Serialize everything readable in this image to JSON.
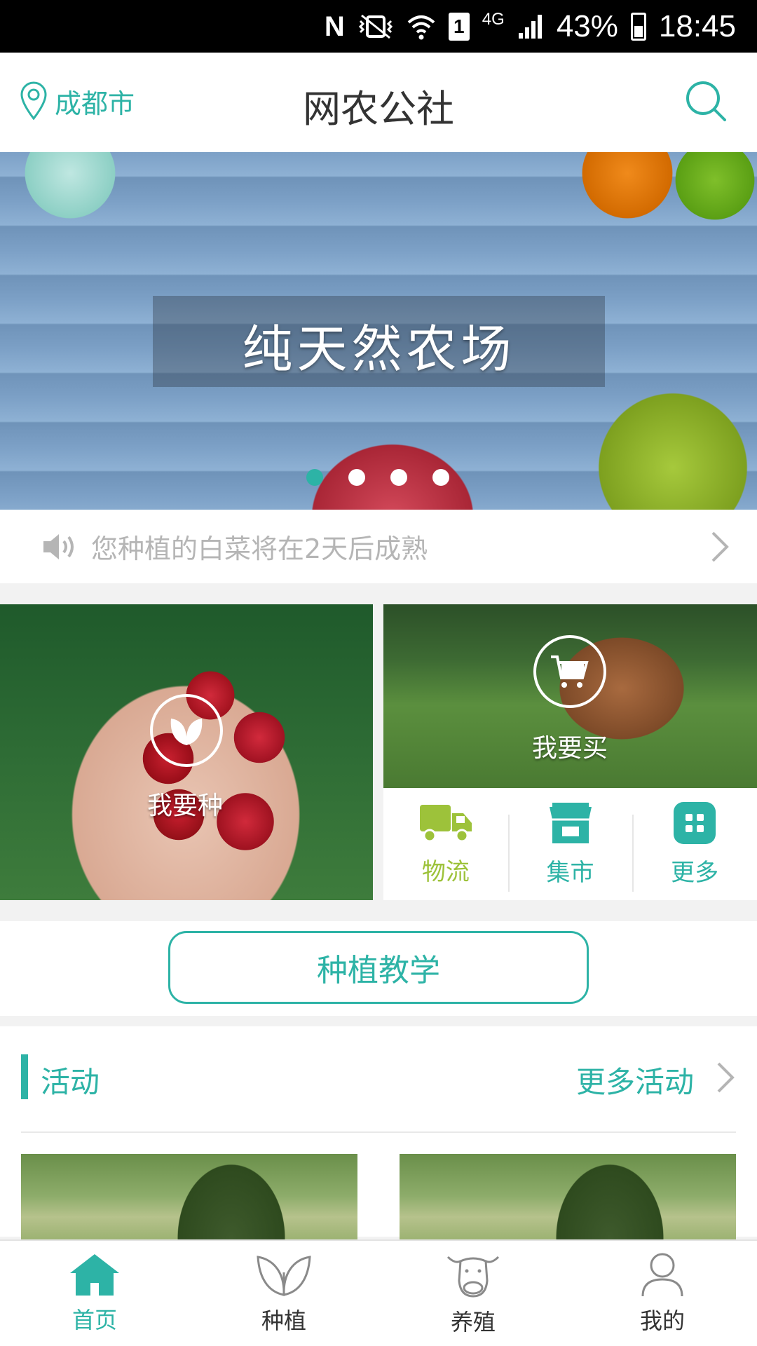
{
  "status_bar": {
    "battery": "43%",
    "time": "18:45",
    "network": "4G",
    "sim_slot": "1",
    "icons": [
      "nfc-icon",
      "vibrate-icon",
      "wifi-icon",
      "sim-icon",
      "signal-icon",
      "battery-icon"
    ]
  },
  "header": {
    "location": "成都市",
    "title": "网农公社",
    "icons": {
      "location": "location-pin-icon",
      "search": "search-icon"
    }
  },
  "banner": {
    "title": "纯天然农场",
    "slide_count": 4,
    "active_slide": 1
  },
  "notice": {
    "text": "您种植的白菜将在2天后成熟",
    "icon": "speaker-icon"
  },
  "features": {
    "plant": {
      "label": "我要种",
      "icon": "leaf-icon"
    },
    "buy": {
      "label": "我要买",
      "icon": "cart-icon"
    }
  },
  "quick_links": [
    {
      "label": "物流",
      "icon": "truck-icon",
      "color": "#9dc23a"
    },
    {
      "label": "集市",
      "icon": "store-icon",
      "color": "#2db3a6"
    },
    {
      "label": "更多",
      "icon": "grid-icon",
      "color": "#2db3a6"
    }
  ],
  "teaching": {
    "label": "种植教学"
  },
  "activities": {
    "title": "活动",
    "more": "更多活动"
  },
  "bottom_nav": [
    {
      "label": "首页",
      "icon": "home-icon",
      "active": true
    },
    {
      "label": "种植",
      "icon": "sprout-icon",
      "active": false
    },
    {
      "label": "养殖",
      "icon": "cow-icon",
      "active": false
    },
    {
      "label": "我的",
      "icon": "user-icon",
      "active": false
    }
  ],
  "colors": {
    "accent": "#2db3a6",
    "logistics": "#9dc23a",
    "muted_text": "#b5b5b5"
  }
}
